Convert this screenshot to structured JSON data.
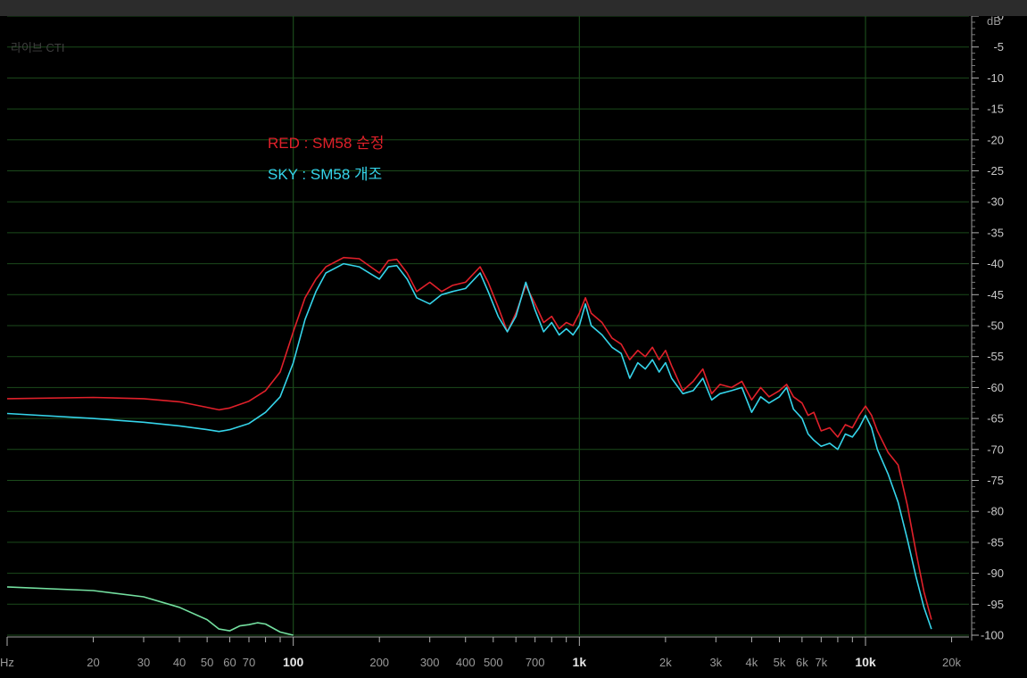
{
  "app": {
    "watermark": "라이브 CTI"
  },
  "legend": {
    "red_label": "RED : SM58 순정",
    "sky_label": "SKY : SM58 개조"
  },
  "colors": {
    "background": "#000000",
    "grid": "#1b4a1b",
    "red": "#e0202a",
    "sky": "#35d4ea",
    "green": "#74e0a0",
    "axis_text": "#9a9a9a",
    "axis_frame": "#b0b0b0"
  },
  "chart_data": {
    "type": "line",
    "title": "",
    "x_scale": "log",
    "xlim": [
      10,
      23000
    ],
    "ylim": [
      -100,
      0
    ],
    "x_tick_labels": [
      {
        "v": 10,
        "t": "Hz"
      },
      {
        "v": 20,
        "t": "20"
      },
      {
        "v": 30,
        "t": "30"
      },
      {
        "v": 40,
        "t": "40"
      },
      {
        "v": 50,
        "t": "50"
      },
      {
        "v": 60,
        "t": "60"
      },
      {
        "v": 70,
        "t": "70"
      },
      {
        "v": 100,
        "t": "100"
      },
      {
        "v": 200,
        "t": "200"
      },
      {
        "v": 300,
        "t": "300"
      },
      {
        "v": 400,
        "t": "400"
      },
      {
        "v": 500,
        "t": "500"
      },
      {
        "v": 700,
        "t": "700"
      },
      {
        "v": 1000,
        "t": "1k"
      },
      {
        "v": 2000,
        "t": "2k"
      },
      {
        "v": 3000,
        "t": "3k"
      },
      {
        "v": 4000,
        "t": "4k"
      },
      {
        "v": 5000,
        "t": "5k"
      },
      {
        "v": 6000,
        "t": "6k"
      },
      {
        "v": 7000,
        "t": "7k"
      },
      {
        "v": 10000,
        "t": "10k"
      },
      {
        "v": 20000,
        "t": "20k"
      }
    ],
    "x_major_grid": [
      100,
      1000,
      10000
    ],
    "y_unit": "dB",
    "y_ticks": [
      0,
      -5,
      -10,
      -15,
      -20,
      -25,
      -30,
      -35,
      -40,
      -45,
      -50,
      -55,
      -60,
      -65,
      -70,
      -75,
      -80,
      -85,
      -90,
      -95,
      -100
    ],
    "grid": true,
    "series": [
      {
        "name": "RED : SM58 순정",
        "color": "#e0202a",
        "x": [
          10,
          20,
          30,
          40,
          50,
          55,
          60,
          70,
          80,
          90,
          100,
          110,
          120,
          130,
          150,
          170,
          180,
          200,
          215,
          230,
          250,
          270,
          300,
          330,
          360,
          400,
          450,
          480,
          520,
          560,
          600,
          650,
          700,
          750,
          800,
          850,
          900,
          950,
          1000,
          1050,
          1100,
          1200,
          1300,
          1400,
          1500,
          1600,
          1700,
          1800,
          1900,
          2000,
          2100,
          2300,
          2500,
          2700,
          2900,
          3100,
          3400,
          3700,
          4000,
          4300,
          4600,
          5000,
          5300,
          5600,
          6000,
          6300,
          6600,
          7000,
          7500,
          8000,
          8500,
          9000,
          9500,
          10000,
          10500,
          11000,
          12000,
          13000,
          14000,
          15000,
          16000,
          17000
        ],
        "y": [
          -61.8,
          -61.6,
          -61.8,
          -62.3,
          -63.2,
          -63.6,
          -63.3,
          -62.2,
          -60.5,
          -57.5,
          -51.0,
          -45.5,
          -42.5,
          -40.5,
          -39.0,
          -39.2,
          -40.0,
          -41.5,
          -39.5,
          -39.3,
          -41.5,
          -44.5,
          -43.0,
          -44.5,
          -43.5,
          -43.0,
          -40.5,
          -43.0,
          -47.0,
          -51.0,
          -48.0,
          -43.5,
          -46.5,
          -49.5,
          -48.5,
          -50.5,
          -49.5,
          -50.0,
          -48.0,
          -45.5,
          -48.0,
          -49.5,
          -52.0,
          -53.0,
          -55.5,
          -54.0,
          -55.0,
          -53.5,
          -55.5,
          -54.0,
          -56.5,
          -60.5,
          -59.0,
          -57.0,
          -61.0,
          -59.5,
          -60.0,
          -59.0,
          -62.0,
          -60.0,
          -61.5,
          -60.5,
          -59.5,
          -61.5,
          -62.5,
          -64.5,
          -64.0,
          -67.0,
          -66.5,
          -68.0,
          -66.0,
          -66.5,
          -64.5,
          -63.0,
          -64.5,
          -67.0,
          -70.5,
          -72.5,
          -79.0,
          -86.5,
          -93.0,
          -97.5
        ]
      },
      {
        "name": "SKY : SM58 개조",
        "color": "#35d4ea",
        "x": [
          10,
          20,
          30,
          40,
          50,
          55,
          60,
          70,
          80,
          90,
          100,
          110,
          120,
          130,
          150,
          170,
          180,
          200,
          215,
          230,
          250,
          270,
          300,
          330,
          360,
          400,
          450,
          480,
          520,
          560,
          600,
          650,
          700,
          750,
          800,
          850,
          900,
          950,
          1000,
          1050,
          1100,
          1200,
          1300,
          1400,
          1500,
          1600,
          1700,
          1800,
          1900,
          2000,
          2100,
          2300,
          2500,
          2700,
          2900,
          3100,
          3400,
          3700,
          4000,
          4300,
          4600,
          5000,
          5300,
          5600,
          6000,
          6300,
          6600,
          7000,
          7500,
          8000,
          8500,
          9000,
          9500,
          10000,
          10500,
          11000,
          12000,
          13000,
          14000,
          15000,
          16000,
          17000
        ],
        "y": [
          -64.2,
          -65.0,
          -65.6,
          -66.2,
          -66.8,
          -67.1,
          -66.8,
          -65.8,
          -64.0,
          -61.5,
          -56.0,
          -49.0,
          -44.5,
          -41.5,
          -40.0,
          -40.5,
          -41.2,
          -42.5,
          -40.5,
          -40.3,
          -42.5,
          -45.5,
          -46.5,
          -45.0,
          -44.5,
          -44.0,
          -41.5,
          -44.5,
          -48.5,
          -51.0,
          -48.5,
          -43.0,
          -47.5,
          -51.0,
          -49.5,
          -51.5,
          -50.5,
          -51.5,
          -50.0,
          -46.5,
          -50.0,
          -51.5,
          -53.5,
          -54.5,
          -58.5,
          -56.0,
          -57.0,
          -55.5,
          -57.5,
          -56.0,
          -58.5,
          -61.0,
          -60.5,
          -58.5,
          -62.0,
          -61.0,
          -60.5,
          -60.0,
          -64.0,
          -61.5,
          -62.5,
          -61.5,
          -60.0,
          -63.5,
          -65.0,
          -67.5,
          -68.5,
          -69.5,
          -69.0,
          -70.0,
          -67.5,
          -68.0,
          -66.5,
          -64.5,
          -66.5,
          -70.0,
          -74.0,
          -78.5,
          -84.5,
          -90.5,
          -95.5,
          -99.0
        ]
      },
      {
        "name": "",
        "color": "#74e0a0",
        "x": [
          10,
          20,
          30,
          40,
          50,
          55,
          60,
          65,
          70,
          75,
          80,
          90,
          100
        ],
        "y": [
          -92.2,
          -92.8,
          -93.8,
          -95.5,
          -97.5,
          -99.0,
          -99.3,
          -98.5,
          -98.3,
          -98.0,
          -98.2,
          -99.5,
          -100
        ]
      }
    ]
  }
}
